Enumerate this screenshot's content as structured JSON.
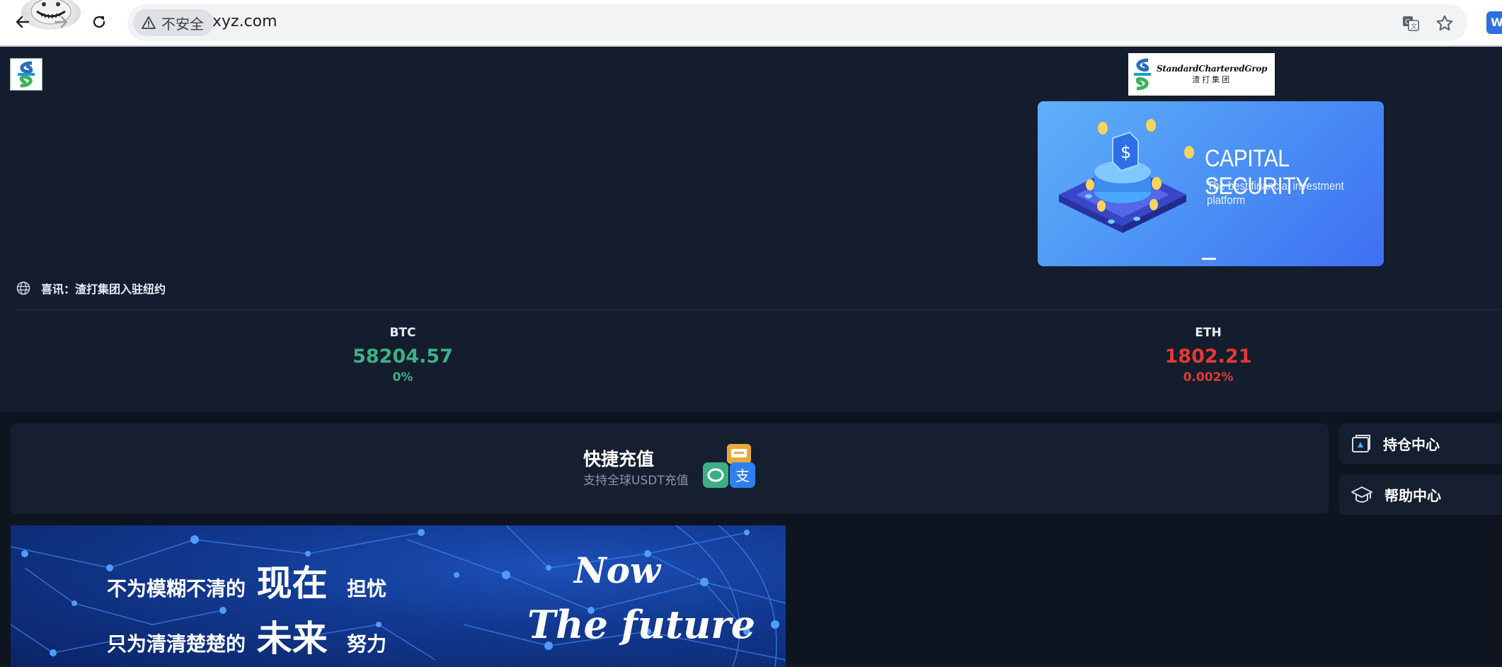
{
  "browser": {
    "security_label": "不安全",
    "url": "xyz.com",
    "extension_badge": "W",
    "icons": [
      "back-arrow-icon",
      "reload-icon",
      "warning-icon",
      "translate-icon",
      "star-icon"
    ]
  },
  "hero": {
    "brand_name": "StandardCharteredGrop",
    "brand_cn": "渣打集团",
    "carousel": {
      "title": "CAPITAL SECURITY",
      "subtitle": "The best financial investment platform",
      "active_slide": 1
    },
    "notice": "喜讯：渣打集团入驻纽约"
  },
  "tickers": [
    {
      "symbol": "BTC",
      "price": "58204.57",
      "change": "0%",
      "color": "#3fae85"
    },
    {
      "symbol": "ETH",
      "price": "1802.21",
      "change": "0.002%",
      "color": "#e53935"
    }
  ],
  "recharge": {
    "title": "快捷充值",
    "subtitle": "支持全球USDT充值",
    "alipay_glyph": "支"
  },
  "side_menu": [
    {
      "label": "持仓中心",
      "icon": "wallet-icon"
    },
    {
      "label": "帮助中心",
      "icon": "graduation-cap-icon"
    }
  ],
  "promo": {
    "line1_prefix": "不为模糊不清的",
    "line1_big": "现在",
    "line1_suffix": "担忧",
    "line2_prefix": "只为清清楚楚的",
    "line2_big": "未来",
    "line2_suffix": "努力",
    "en_line1": "Now",
    "en_line2": "The future"
  },
  "colors": {
    "background": "#141d2d",
    "card": "#151f2f",
    "up": "#3fae85",
    "down": "#e53935",
    "carousel_gradient_start": "#5fb0f8",
    "carousel_gradient_end": "#3f6ff2"
  }
}
